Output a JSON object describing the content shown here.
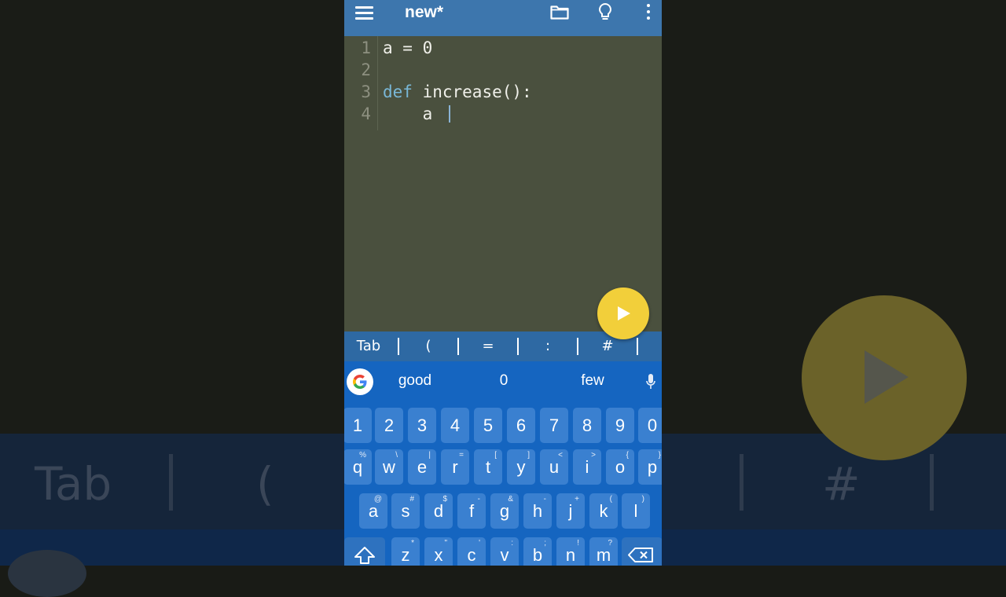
{
  "app": {
    "title": "new*",
    "icons": [
      "menu-icon",
      "folder-icon",
      "bulb-icon",
      "more-vert-icon"
    ]
  },
  "editor": {
    "lines": [
      {
        "num": "1",
        "code": "a = 0"
      },
      {
        "num": "2",
        "code": ""
      },
      {
        "num": "3",
        "kw": "def",
        "code": " increase():"
      },
      {
        "num": "4",
        "code": "    a "
      }
    ]
  },
  "run_button": {
    "icon": "play-icon"
  },
  "key_bar": {
    "keys": [
      "Tab",
      "(",
      "=",
      ":",
      "#"
    ]
  },
  "keyboard": {
    "suggestions": [
      "good",
      "0",
      "few"
    ],
    "row_numbers": [
      "1",
      "2",
      "3",
      "4",
      "5",
      "6",
      "7",
      "8",
      "9",
      "0"
    ],
    "row1": [
      "q",
      "w",
      "e",
      "r",
      "t",
      "y",
      "u",
      "i",
      "o",
      "p"
    ],
    "row1_alt": [
      "%",
      "\\",
      "|",
      "=",
      "[",
      "]",
      "<",
      ">",
      "{",
      "}"
    ],
    "row2": [
      "a",
      "s",
      "d",
      "f",
      "g",
      "h",
      "j",
      "k",
      "l"
    ],
    "row2_alt": [
      "@",
      "#",
      "$",
      "-",
      "&",
      "-",
      "+",
      "(",
      ")"
    ],
    "row3": [
      "z",
      "x",
      "c",
      "v",
      "b",
      "n",
      "m"
    ],
    "row3_alt": [
      "*",
      "\"",
      "'",
      ":",
      ";",
      "!",
      "?"
    ]
  },
  "background": {
    "tab": "Tab",
    "paren": "(",
    "hash": "#"
  },
  "colors": {
    "appbar": "#3d76ad",
    "editor_bg": "#4a503e",
    "keyword": "#79b7d7",
    "fab": "#f2cf3a",
    "keyboard": "#1565c0"
  }
}
